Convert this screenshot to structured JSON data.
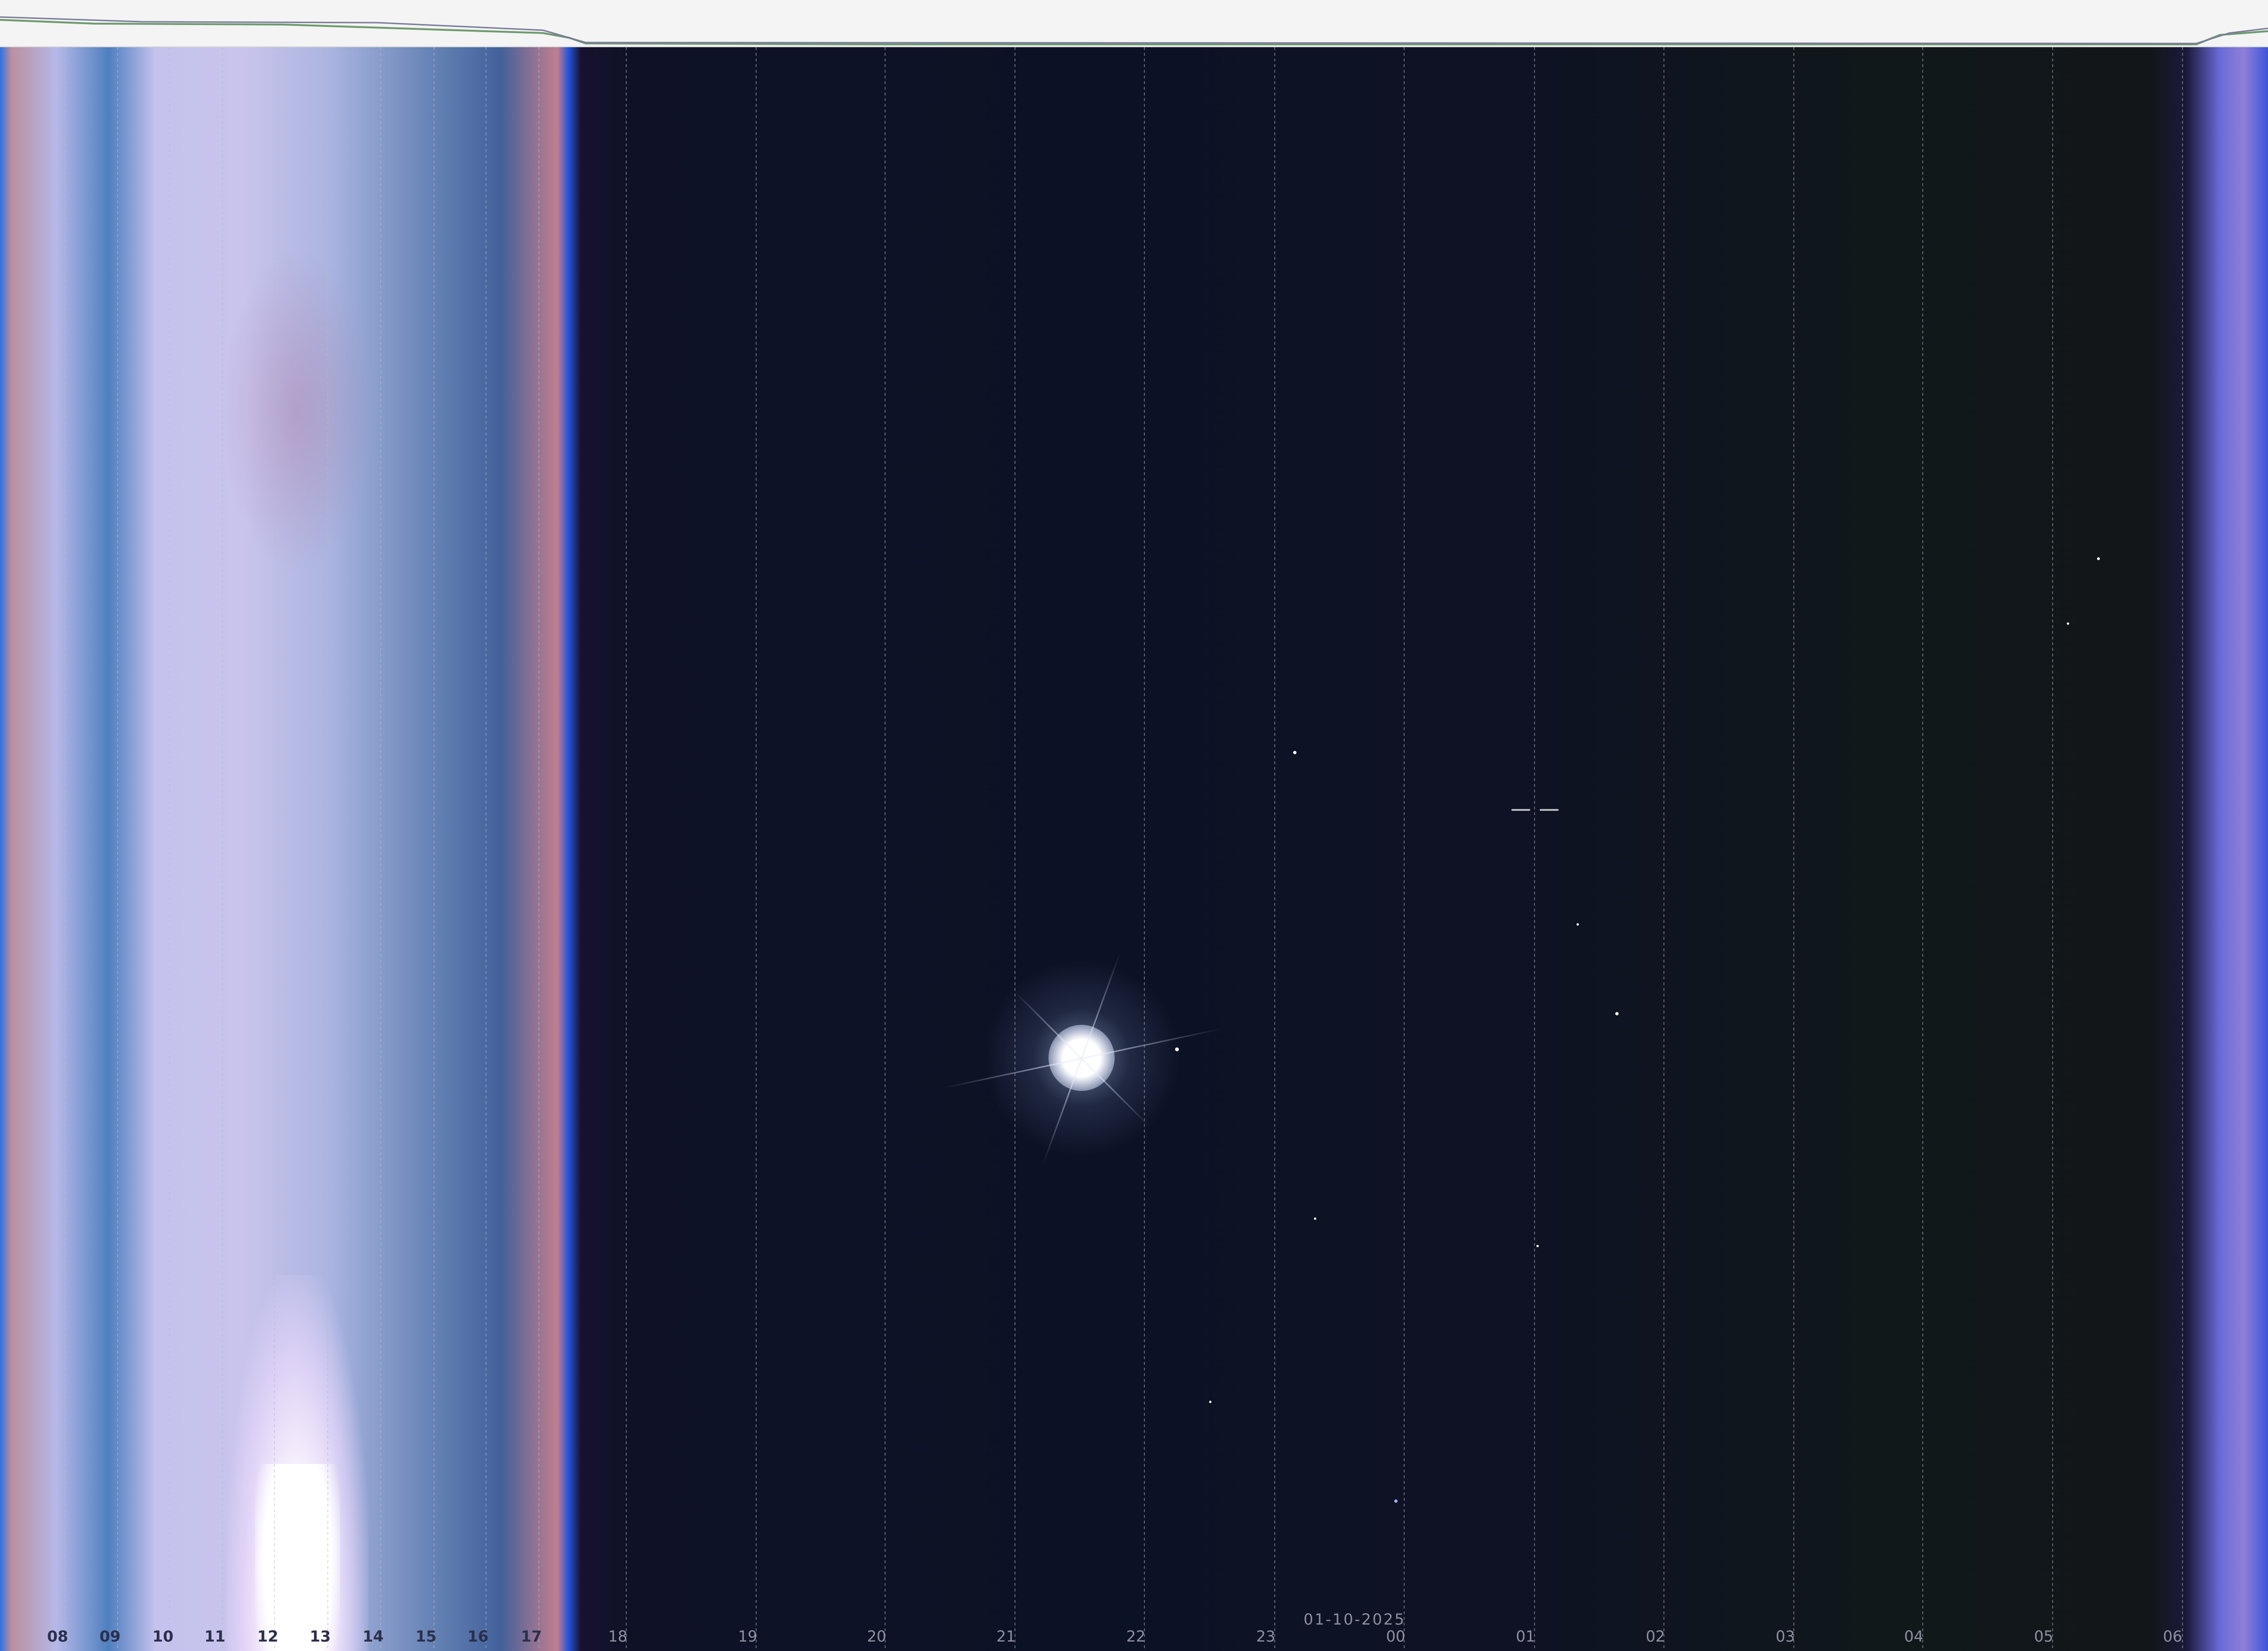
{
  "image": {
    "hour_labels": [
      "08",
      "09",
      "10",
      "11",
      "12",
      "13",
      "14",
      "15",
      "16",
      "17",
      "18",
      "19",
      "20",
      "21",
      "22",
      "23",
      "00",
      "01",
      "02",
      "03",
      "04",
      "05",
      "06"
    ],
    "date_label": "01-10-2025",
    "colors": {
      "day_sky": "#c5c2ee",
      "night_sky": "#0c1225",
      "header_strip": "#f4f4f4",
      "day_label": "#2b2f4a",
      "night_label": "#8f8fa0"
    }
  }
}
